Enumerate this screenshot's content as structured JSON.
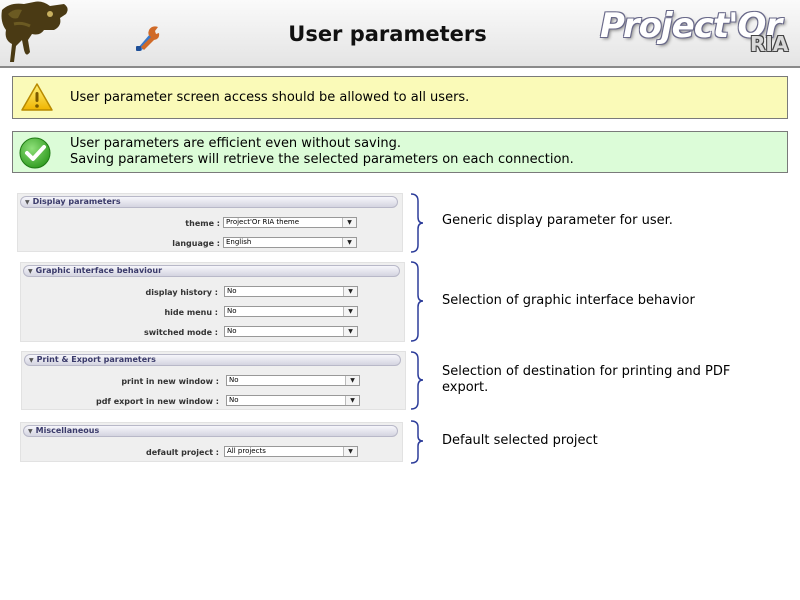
{
  "header": {
    "title": "User parameters",
    "brand_name": "Project'Or",
    "brand_suffix": "RIA"
  },
  "messages": {
    "warning": "User parameter screen access should be allowed to all users.",
    "info_line1": "User parameters are efficient even without saving.",
    "info_line2": "Saving parameters will retrieve the selected parameters on each connection."
  },
  "panels": [
    {
      "title": "Display parameters",
      "fields": [
        {
          "label": "theme :",
          "value": "Project'Or RIA theme"
        },
        {
          "label": "language :",
          "value": "English"
        }
      ],
      "note": "Generic display parameter for user."
    },
    {
      "title": "Graphic interface behaviour",
      "fields": [
        {
          "label": "display history :",
          "value": "No"
        },
        {
          "label": "hide menu :",
          "value": "No"
        },
        {
          "label": "switched mode :",
          "value": "No"
        }
      ],
      "note": "Selection of graphic interface behavior"
    },
    {
      "title": "Print & Export parameters",
      "fields": [
        {
          "label": "print in new window :",
          "value": "No"
        },
        {
          "label": "pdf export in new window :",
          "value": "No"
        }
      ],
      "note": "Selection of destination for printing and PDF export."
    },
    {
      "title": "Miscellaneous",
      "fields": [
        {
          "label": "default project :",
          "value": "All projects"
        }
      ],
      "note": "Default selected project"
    }
  ],
  "icons": {
    "logo": "chameleon-logo-icon",
    "tool": "wrench-screwdriver-icon",
    "warning": "warning-triangle-icon",
    "success": "green-check-icon",
    "collapse": "triangle-down-icon",
    "dropdown": "chevron-down-icon"
  },
  "colors": {
    "warning_bg": "#fafab8",
    "success_bg": "#dcfcd8",
    "bracket": "#2d3d9a"
  }
}
